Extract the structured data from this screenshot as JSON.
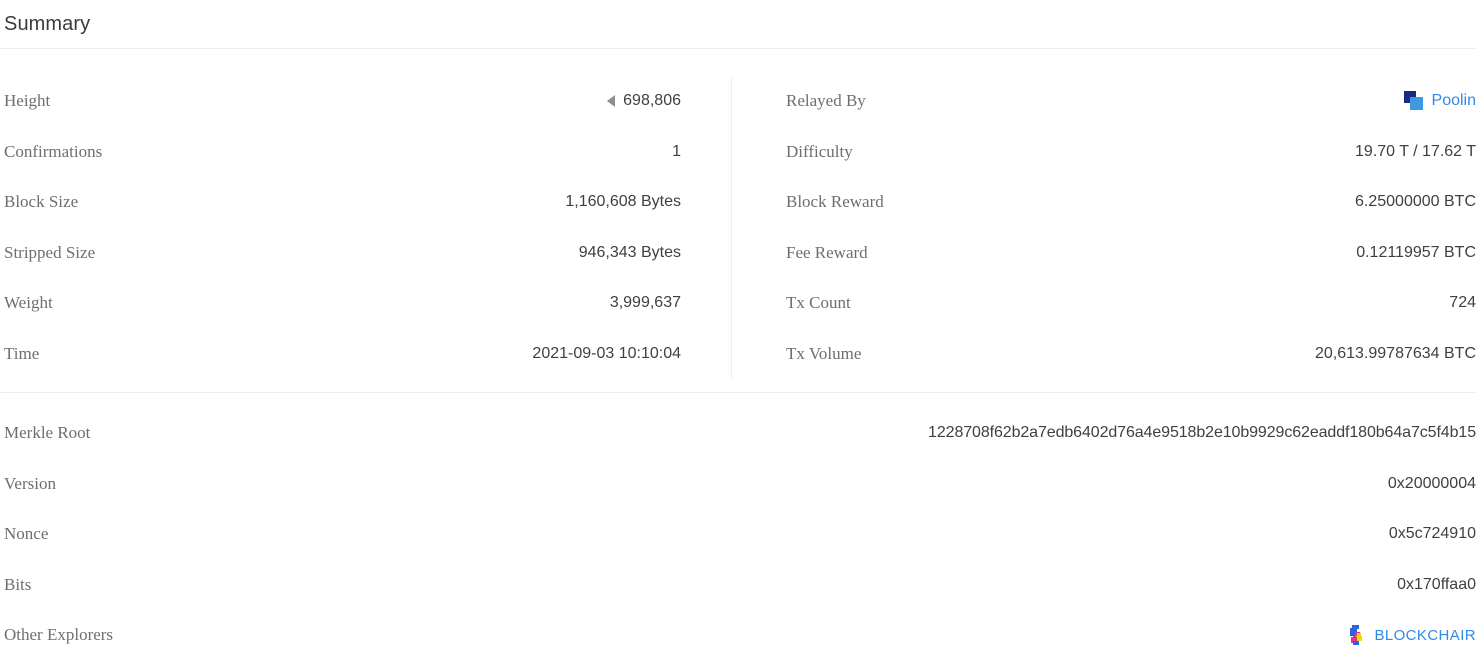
{
  "header": {
    "title": "Summary"
  },
  "left_column": {
    "rows": [
      {
        "label": "Height",
        "value": "698,806",
        "has_prev_arrow": true
      },
      {
        "label": "Confirmations",
        "value": "1"
      },
      {
        "label": "Block Size",
        "value": "1,160,608 Bytes"
      },
      {
        "label": "Stripped Size",
        "value": "946,343 Bytes"
      },
      {
        "label": "Weight",
        "value": "3,999,637"
      },
      {
        "label": "Time",
        "value": "2021-09-03 10:10:04"
      }
    ]
  },
  "right_column": {
    "rows": [
      {
        "label": "Relayed By",
        "value": "Poolin",
        "is_link": true,
        "icon": "poolin-logo"
      },
      {
        "label": "Difficulty",
        "value": "19.70 T / 17.62 T"
      },
      {
        "label": "Block Reward",
        "value": "6.25000000 BTC"
      },
      {
        "label": "Fee Reward",
        "value": "0.12119957 BTC"
      },
      {
        "label": "Tx Count",
        "value": "724"
      },
      {
        "label": "Tx Volume",
        "value": "20,613.99787634 BTC"
      }
    ]
  },
  "bottom_section": {
    "rows": [
      {
        "label": "Merkle Root",
        "value": "1228708f62b2a7edb6402d76a4e9518b2e10b9929c62eaddf180b64a7c5f4b15"
      },
      {
        "label": "Version",
        "value": "0x20000004"
      },
      {
        "label": "Nonce",
        "value": "0x5c724910"
      },
      {
        "label": "Bits",
        "value": "0x170ffaa0"
      },
      {
        "label": "Other Explorers",
        "value": "BLOCKCHAIR",
        "is_link": true,
        "icon": "blockchair-logo"
      }
    ]
  },
  "colors": {
    "link": "#2f8be6",
    "label": "#6e6e72",
    "value": "#3f3f44",
    "divider": "#eceef0",
    "poolin_dark": "#1b2a80",
    "poolin_light": "#3d9ae0",
    "blockchair_blue": "#2f62d8",
    "blockchair_magenta": "#e8318a",
    "blockchair_yellow": "#f5d800"
  }
}
